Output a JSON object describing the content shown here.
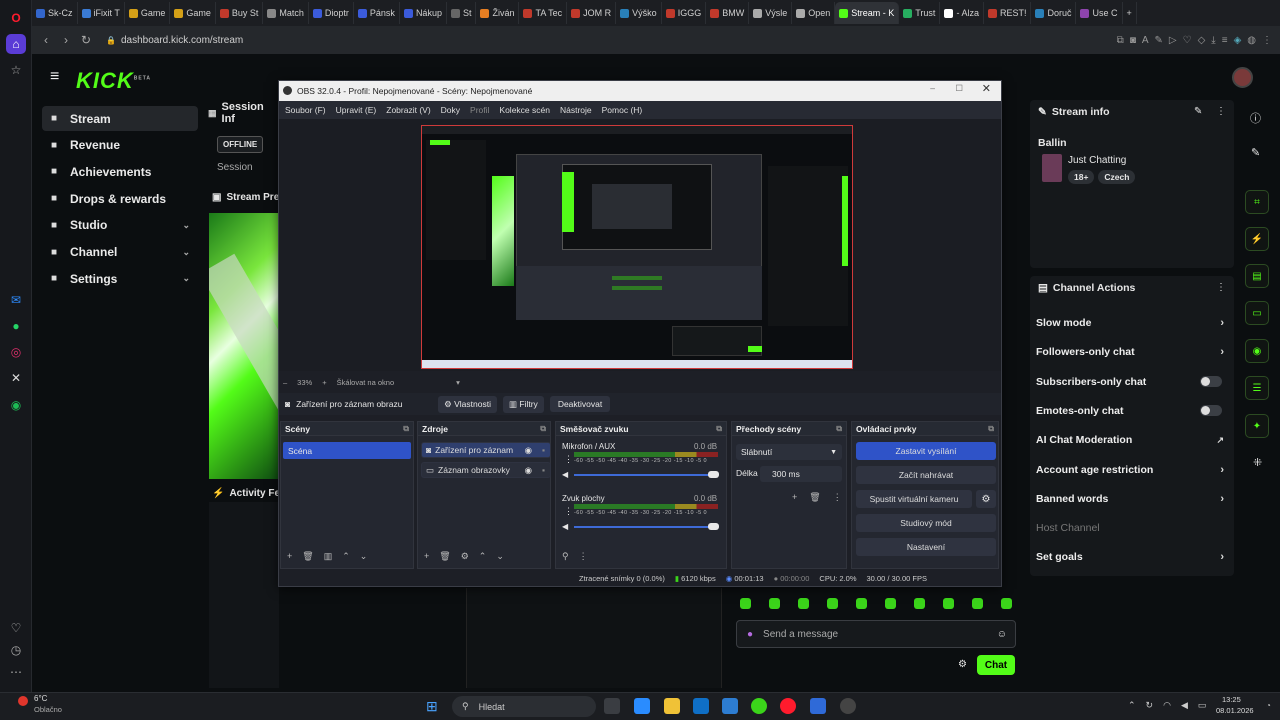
{
  "browser": {
    "tabs": [
      {
        "label": "Sk-Cz",
        "color": "#3366cc"
      },
      {
        "label": "iFixit T",
        "color": "#3a7bd5"
      },
      {
        "label": "Game",
        "color": "#d4a017"
      },
      {
        "label": "Game",
        "color": "#d4a017"
      },
      {
        "label": "Buy St",
        "color": "#c0392b"
      },
      {
        "label": "Match",
        "color": "#888888"
      },
      {
        "label": "Dioptr",
        "color": "#3b5bdb"
      },
      {
        "label": "Pánsk",
        "color": "#3b5bdb"
      },
      {
        "label": "Nákup",
        "color": "#3b5bdb"
      },
      {
        "label": "St",
        "color": "#666666"
      },
      {
        "label": "Živán",
        "color": "#e67e22"
      },
      {
        "label": "TA Tec",
        "color": "#c0392b"
      },
      {
        "label": "JOM R",
        "color": "#c0392b"
      },
      {
        "label": "Výško",
        "color": "#2980b9"
      },
      {
        "label": "IGGG",
        "color": "#c0392b"
      },
      {
        "label": "BMW",
        "color": "#c0392b"
      },
      {
        "label": "Výsle",
        "color": "#aaaaaa"
      },
      {
        "label": "Open",
        "color": "#aaaaaa"
      },
      {
        "label": "Stream - K",
        "color": "#53fc18",
        "active": true
      },
      {
        "label": "Trust",
        "color": "#27ae60"
      },
      {
        "label": "- Alza",
        "color": "#ffffff"
      },
      {
        "label": "REST!",
        "color": "#c0392b"
      },
      {
        "label": "Doruč",
        "color": "#2980b9"
      },
      {
        "label": "Use C",
        "color": "#8e44ad"
      }
    ],
    "url": "dashboard.kick.com/stream"
  },
  "kick": {
    "logo": "KICK",
    "logo_sup": "BETA",
    "nav": [
      {
        "label": "Stream",
        "icon": "signal-icon",
        "selected": true
      },
      {
        "label": "Revenue",
        "icon": "money-icon"
      },
      {
        "label": "Achievements",
        "icon": "trophy-icon"
      },
      {
        "label": "Drops & rewards",
        "icon": "gift-icon"
      },
      {
        "label": "Studio",
        "icon": "studio-icon",
        "chevron": true
      },
      {
        "label": "Channel",
        "icon": "channel-icon",
        "chevron": true
      },
      {
        "label": "Settings",
        "icon": "gear-icon",
        "chevron": true
      }
    ],
    "session_title": "Session Inf",
    "offline": "OFFLINE",
    "session_label": "Session",
    "stream_preview": "Stream Pre",
    "activity_feed": "Activity Fe",
    "stream_info": {
      "title": "Stream info",
      "stream_title": "Ballin",
      "category": "Just Chatting",
      "tags": [
        "18+",
        "Czech"
      ]
    },
    "channel_actions": {
      "title": "Channel Actions",
      "items": [
        {
          "label": "Slow mode",
          "type": "arrow"
        },
        {
          "label": "Followers-only chat",
          "type": "arrow"
        },
        {
          "label": "Subscribers-only chat",
          "type": "toggle"
        },
        {
          "label": "Emotes-only chat",
          "type": "toggle"
        },
        {
          "label": "AI Chat Moderation",
          "type": "external"
        },
        {
          "label": "Account age restriction",
          "type": "arrow"
        },
        {
          "label": "Banned words",
          "type": "arrow"
        },
        {
          "label": "Host Channel",
          "type": "disabled"
        },
        {
          "label": "Set goals",
          "type": "arrow"
        }
      ]
    },
    "chat": {
      "placeholder": "Send a message",
      "send_label": "Chat"
    }
  },
  "obs": {
    "title": "OBS 32.0.4 - Profil: Nepojmenované - Scény: Nepojmenované",
    "menu": [
      "Soubor (F)",
      "Upravit (E)",
      "Zobrazit (V)",
      "Doky",
      "Profil",
      "Kolekce scén",
      "Nástroje",
      "Pomoc (H)"
    ],
    "zoom": "33%",
    "scale_label": "Škálovat na okno",
    "source_bar": {
      "source": "Zařízení pro záznam obrazu",
      "properties": "Vlastnosti",
      "filters": "Filtry",
      "deactivate": "Deaktivovat"
    },
    "scenes": {
      "title": "Scény",
      "items": [
        "Scéna"
      ]
    },
    "sources": {
      "title": "Zdroje",
      "items": [
        "Zařízení pro záznam",
        "Záznam obrazovky"
      ]
    },
    "mixer": {
      "title": "Směšovač zvuku",
      "channels": [
        {
          "name": "Mikrofon / AUX",
          "db": "0.0 dB"
        },
        {
          "name": "Zvuk plochy",
          "db": "0.0 dB"
        }
      ],
      "ticks": "-60 -55 -50 -45 -40 -35 -30 -25 -20 -15 -10 -5 0"
    },
    "transitions": {
      "title": "Přechody scény",
      "type": "Slábnutí",
      "duration_label": "Délka",
      "duration": "300 ms"
    },
    "controls": {
      "title": "Ovládací prvky",
      "buttons": [
        "Zastavit vysílání",
        "Začít nahrávat",
        "Spustit virtuální kameru",
        "Studiový mód",
        "Nastavení"
      ]
    },
    "status": {
      "dropped": "Ztracené snímky 0 (0.0%)",
      "bitrate": "6120 kbps",
      "live_time": "00:01:13",
      "rec_time": "00:00:00",
      "cpu": "CPU: 2.0%",
      "fps": "30.00 / 30.00 FPS"
    }
  },
  "taskbar": {
    "weather_temp": "6°C",
    "weather_text": "Oblačno",
    "search_placeholder": "Hledat",
    "time": "13:25",
    "date": "08.01.2026"
  }
}
